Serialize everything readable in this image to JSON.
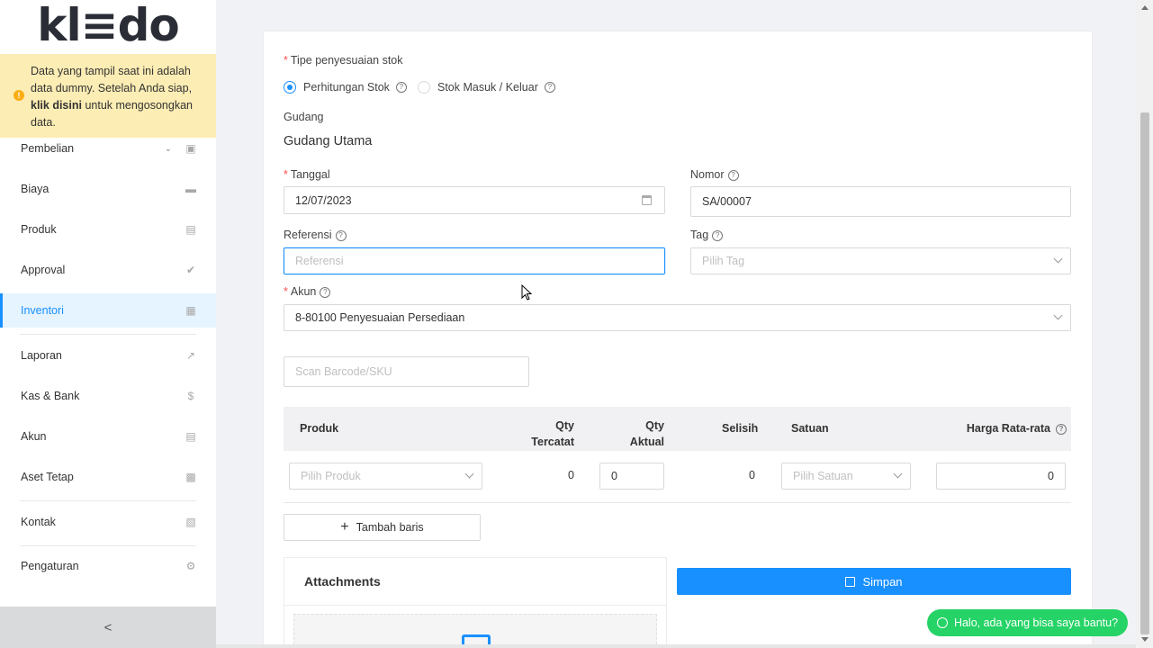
{
  "brand": {
    "logo": "kl≡do"
  },
  "notice": {
    "line1": "Data yang tampil saat ini adalah data dummy. Setelah Anda siap, ",
    "bold": "klik disini",
    "line2": " untuk mengosongkan data."
  },
  "sidebar": {
    "items": [
      {
        "label": "Pembelian",
        "icon": "shopping-bag-icon"
      },
      {
        "label": "Biaya",
        "icon": "credit-card-icon"
      },
      {
        "label": "Produk",
        "icon": "box-icon"
      },
      {
        "label": "Approval",
        "icon": "check-icon"
      },
      {
        "label": "Inventori",
        "icon": "warehouse-icon",
        "active": true
      },
      {
        "label": "Laporan",
        "icon": "chart-line-icon"
      },
      {
        "label": "Kas & Bank",
        "icon": "dollar-icon"
      },
      {
        "label": "Akun",
        "icon": "list-icon"
      },
      {
        "label": "Aset Tetap",
        "icon": "building-icon"
      },
      {
        "label": "Kontak",
        "icon": "contact-card-icon"
      },
      {
        "label": "Pengaturan",
        "icon": "gears-icon"
      }
    ],
    "collapse": "<"
  },
  "form": {
    "type_label": "Tipe penyesuaian stok",
    "type_options": [
      "Perhitungan Stok",
      "Stok Masuk / Keluar"
    ],
    "type_selected": "Perhitungan Stok",
    "warehouse_label": "Gudang",
    "warehouse_value": "Gudang Utama",
    "date_label": "Tanggal",
    "date_value": "12/07/2023",
    "number_label": "Nomor",
    "number_value": "SA/00007",
    "reference_label": "Referensi",
    "reference_placeholder": "Referensi",
    "tag_label": "Tag",
    "tag_placeholder": "Pilih Tag",
    "account_label": "Akun",
    "account_value": "8-80100 Penyesuaian Persediaan",
    "scan_placeholder": "Scan Barcode/SKU"
  },
  "table": {
    "headers": {
      "product": "Produk",
      "qty_recorded_1": "Qty",
      "qty_recorded_2": "Tercatat",
      "qty_actual_1": "Qty",
      "qty_actual_2": "Aktual",
      "difference": "Selisih",
      "unit": "Satuan",
      "avg_price": "Harga Rata-rata"
    },
    "row": {
      "product_placeholder": "Pilih Produk",
      "qty_recorded": "0",
      "qty_actual": "0",
      "difference": "0",
      "unit_placeholder": "Pilih Satuan",
      "avg_price": "0"
    },
    "add_row": "Tambah baris"
  },
  "attachments": {
    "title": "Attachments"
  },
  "actions": {
    "save": "Simpan"
  },
  "chat": {
    "label": "Halo, ada yang bisa saya bantu?"
  },
  "colors": {
    "primary": "#1890ff",
    "notice_bg": "#fcedb4",
    "whatsapp": "#25d366",
    "required": "#ff4d4f"
  }
}
